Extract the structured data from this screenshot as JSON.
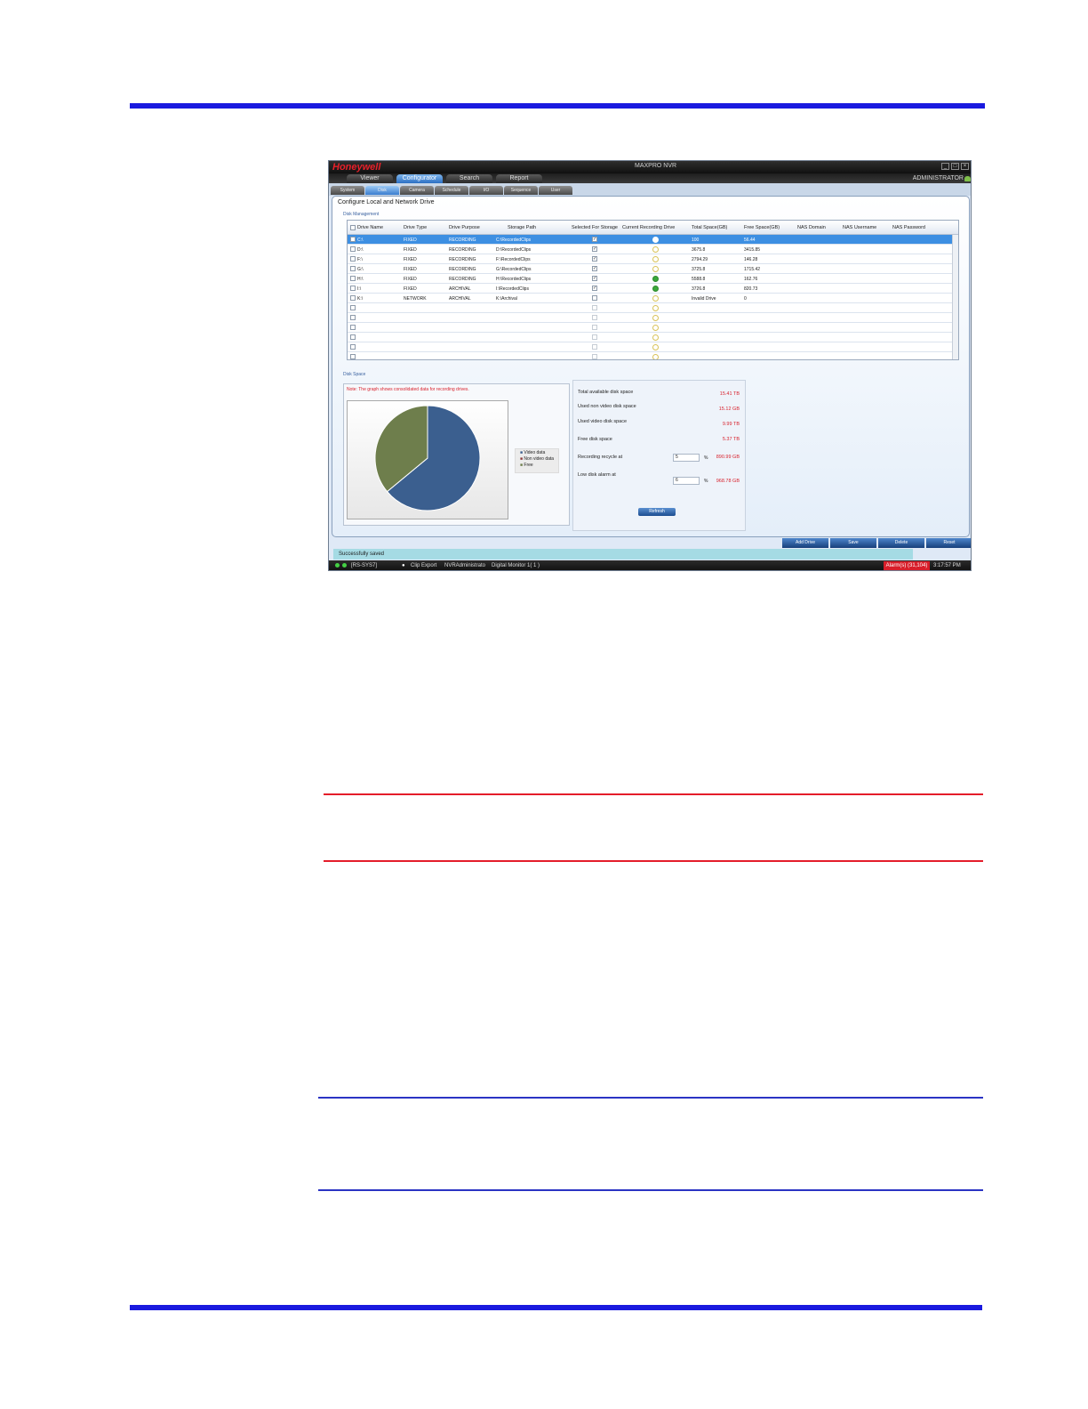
{
  "window": {
    "logo": "Honeywell",
    "title": "MAXPRO NVR",
    "user": "ADMINISTRATOR"
  },
  "menu": [
    "Viewer",
    "Configurator",
    "Search",
    "Report"
  ],
  "subtabs": [
    "System",
    "Disk",
    "Camera",
    "Schedule",
    "I/O",
    "Sequence",
    "User"
  ],
  "panel": {
    "title": "Configure Local and Network Drive",
    "disk_management_label": "Disk Management",
    "disk_space_label": "Disk Space"
  },
  "grid": {
    "headers": [
      "Drive Name",
      "Drive Type",
      "Drive Purpose",
      "Storage Path",
      "Selected For Storage",
      "Current Recording Drive",
      "Total Space(GB)",
      "Free Space(GB)",
      "NAS Domain",
      "NAS Username",
      "NAS Password"
    ],
    "rows": [
      {
        "name": "C:\\",
        "type": "FIXED",
        "purpose": "RECORDING",
        "path": "C:\\RecordedClips",
        "selected": true,
        "recording": "white",
        "total": "100",
        "free": "56.44"
      },
      {
        "name": "D:\\",
        "type": "FIXED",
        "purpose": "RECORDING",
        "path": "D:\\RecordedClips",
        "selected": true,
        "recording": "empty",
        "total": "3675.8",
        "free": "3415.85"
      },
      {
        "name": "F:\\",
        "type": "FIXED",
        "purpose": "RECORDING",
        "path": "F:\\RecordedClips",
        "selected": true,
        "recording": "empty",
        "total": "2794.29",
        "free": "146.28"
      },
      {
        "name": "G:\\",
        "type": "FIXED",
        "purpose": "RECORDING",
        "path": "G:\\RecordedClips",
        "selected": true,
        "recording": "empty",
        "total": "3725.8",
        "free": "1715.42"
      },
      {
        "name": "H:\\",
        "type": "FIXED",
        "purpose": "RECORDING",
        "path": "H:\\RecordedClips",
        "selected": true,
        "recording": "green",
        "total": "5588.8",
        "free": "162.76"
      },
      {
        "name": "I:\\",
        "type": "FIXED",
        "purpose": "ARCHIVAL",
        "path": "I:\\RecordedClips",
        "selected": true,
        "recording": "green",
        "total": "3726.8",
        "free": "820.73"
      },
      {
        "name": "K:\\",
        "type": "NETWORK",
        "purpose": "ARCHIVAL",
        "path": "K:\\Archival",
        "selected": false,
        "recording": "empty",
        "total": "Invalid Drive",
        "free": "0"
      }
    ],
    "empty_rows": 6
  },
  "disk_space": {
    "note": "Note: The graph shows consolidated data for recording drives."
  },
  "chart_data": {
    "type": "pie",
    "categories": [
      "Video data",
      "Non video data",
      "Free"
    ],
    "values": [
      64,
      0.01,
      36
    ],
    "colors": [
      "#3b5f8f",
      "#8b3a3a",
      "#6e7e4c"
    ]
  },
  "stats": {
    "total_label": "Total available disk space",
    "total_value": "15.41  TB",
    "used_non_video_label": "Used non video disk space",
    "used_non_video_value": "15.12  GB",
    "used_video_label": "Used video disk space",
    "used_video_value": "9.99  TB",
    "free_label": "Free disk space",
    "free_value": "5.37  TB",
    "recycle_label": "Recording recycle at",
    "recycle_input": "5",
    "recycle_value": "890.99  GB",
    "alarm_label": "Low disk alarm at",
    "alarm_input": "6",
    "alarm_value": "968.78  GB",
    "percent": "%",
    "refresh": "Refresh"
  },
  "actions": [
    "Add Drive",
    "Save",
    "Delete",
    "Reset"
  ],
  "status_message": "Successfully saved",
  "bottom": {
    "system": "[RS-SYS7]",
    "export": "Clip Export",
    "user": "NVRAdministrato",
    "monitor": "Digital Monitor 1( 1 )",
    "alarms": "Alarm(s) (31,104)",
    "time": "3:17:57 PM"
  },
  "colors": {
    "rule_blue": "#1a1adf",
    "rule_red": "#e41d2a",
    "selection": "#3d8fe2"
  }
}
